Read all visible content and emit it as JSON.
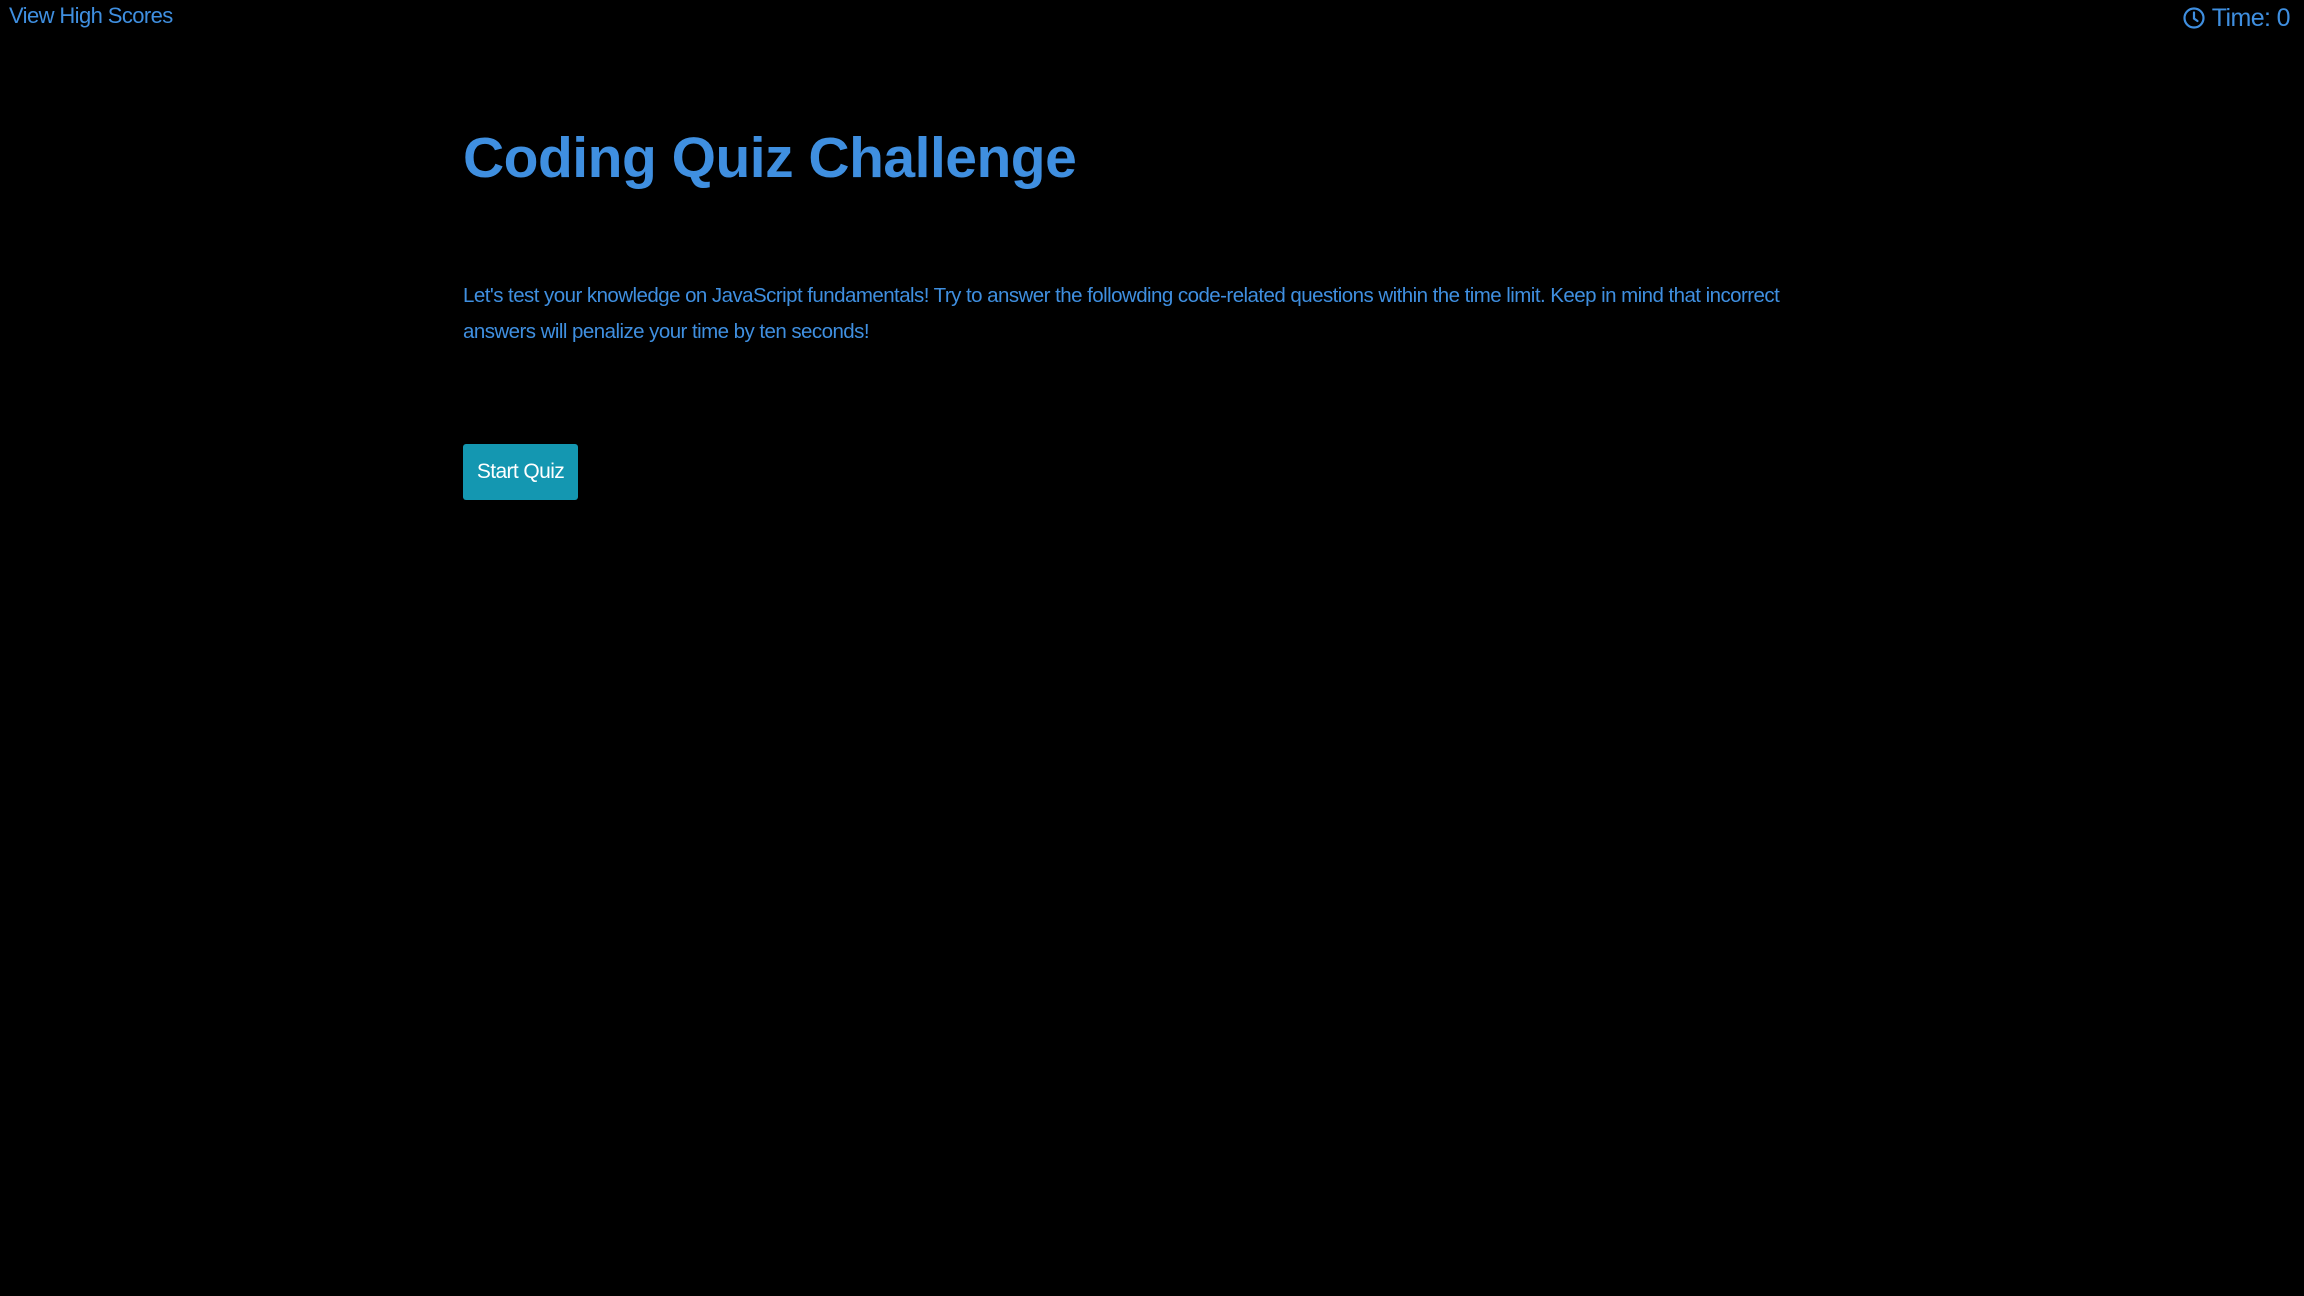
{
  "colors": {
    "background": "#000000",
    "accent": "#3f8fe0",
    "button_bg": "#1497b1",
    "button_text": "#ffffff"
  },
  "header": {
    "high_scores_link": "View High Scores",
    "timer_icon": "clock-icon",
    "timer_label": "Time: 0"
  },
  "main": {
    "title": "Coding Quiz Challenge",
    "intro": "Let's test your knowledge on JavaScript fundamentals! Try to answer the followding code-related questions within the time limit. Keep in mind that incorrect answers will penalize your time by ten seconds!",
    "start_button": "Start Quiz"
  }
}
